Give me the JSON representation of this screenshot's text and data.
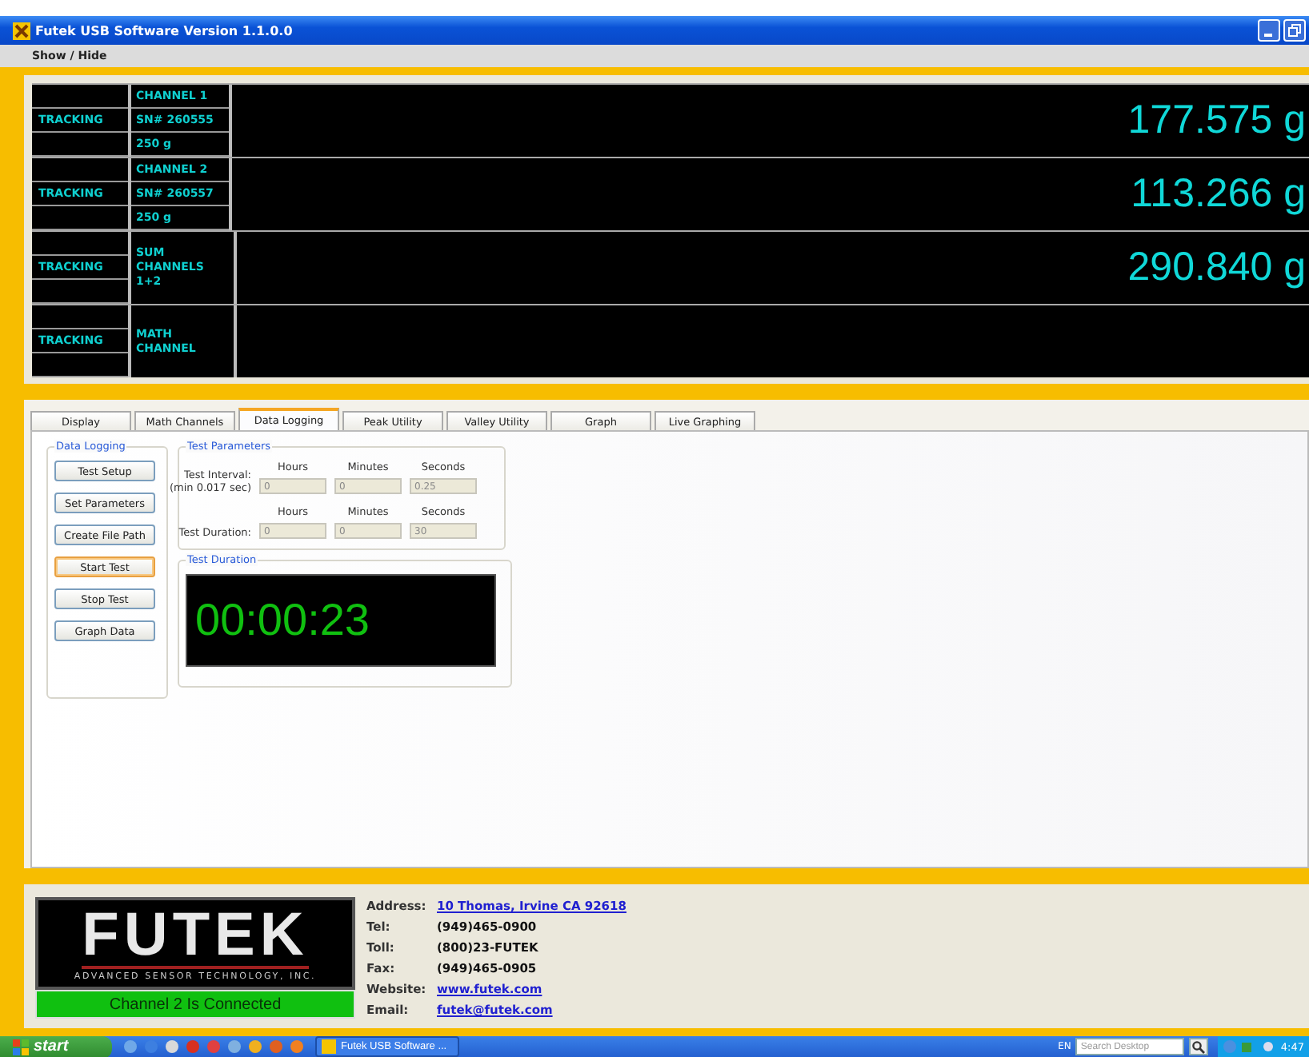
{
  "window": {
    "title": "Futek USB Software Version 1.1.0.0"
  },
  "menu": [
    "Show / Hide"
  ],
  "channels": [
    {
      "kind": "split",
      "status": "TRACKING",
      "label_lines": [
        "CHANNEL 1",
        "SN# 260555",
        "250 g"
      ],
      "reading": "177.575 g"
    },
    {
      "kind": "split",
      "status": "TRACKING",
      "label_lines": [
        "CHANNEL 2",
        "SN# 260557",
        "250 g"
      ],
      "reading": "113.266 g"
    },
    {
      "kind": "merged",
      "status": "TRACKING",
      "label": "SUM CHANNELS 1+2",
      "reading": "290.840 g"
    },
    {
      "kind": "merged",
      "status": "TRACKING",
      "label": "MATH CHANNEL"
    }
  ],
  "tabs": [
    {
      "label": "Display",
      "selected": false
    },
    {
      "label": "Math Channels",
      "selected": false
    },
    {
      "label": "Data Logging",
      "selected": true
    },
    {
      "label": "Peak Utility",
      "selected": false
    },
    {
      "label": "Valley Utility",
      "selected": false
    },
    {
      "label": "Graph",
      "selected": false
    },
    {
      "label": "Live Graphing",
      "selected": false
    }
  ],
  "data_logging": {
    "title": "Data Logging",
    "buttons": [
      {
        "label": "Test Setup",
        "focused": false
      },
      {
        "label": "Set Parameters",
        "focused": false
      },
      {
        "label": "Create File Path",
        "focused": false
      },
      {
        "label": "Start Test",
        "focused": true
      },
      {
        "label": "Stop Test",
        "focused": false
      },
      {
        "label": "Graph Data",
        "focused": false
      }
    ]
  },
  "test_parameters": {
    "title": "Test Parameters",
    "rows": [
      {
        "label_lines": [
          "Test Interval:",
          "(min 0.017 sec)"
        ],
        "headers": [
          "Hours",
          "Minutes",
          "Seconds"
        ],
        "fields": [
          {
            "value": "0",
            "disabled": true
          },
          {
            "value": "0",
            "disabled": true
          },
          {
            "value": "0.25",
            "disabled": true
          }
        ]
      },
      {
        "label_lines": [
          "Test Duration:"
        ],
        "headers": [
          "Hours",
          "Minutes",
          "Seconds"
        ],
        "fields": [
          {
            "value": "0",
            "disabled": true
          },
          {
            "value": "0",
            "disabled": true
          },
          {
            "value": "30",
            "disabled": true
          }
        ]
      }
    ]
  },
  "test_duration": {
    "title": "Test Duration",
    "timer": "00:00:23"
  },
  "footer": {
    "logo": "FUTEK",
    "tagline": "ADVANCED SENSOR TECHNOLOGY, INC.",
    "connection": "Channel 2 Is Connected",
    "contacts": [
      {
        "label": "Address:",
        "value": "10 Thomas, Irvine CA 92618",
        "link": true
      },
      {
        "label": "Tel:",
        "value": "(949)465-0900",
        "link": false
      },
      {
        "label": "Toll:",
        "value": "(800)23-FUTEK",
        "link": false
      },
      {
        "label": "Fax:",
        "value": "(949)465-0905",
        "link": false
      },
      {
        "label": "Website:",
        "value": "www.futek.com",
        "link": true
      },
      {
        "label": "Email:",
        "value": "futek@futek.com",
        "link": true
      }
    ]
  },
  "taskbar": {
    "start": "start",
    "task": "Futek USB Software ...",
    "language": "EN",
    "search": {
      "placeholder": "Search Desktop"
    },
    "clock": "4:47"
  }
}
